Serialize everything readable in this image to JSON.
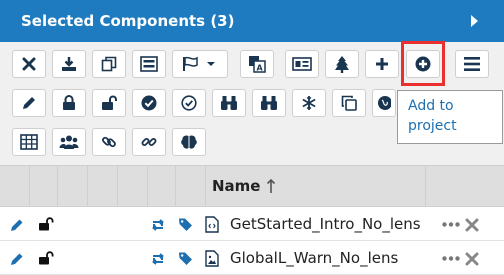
{
  "header": {
    "title": "Selected Components (3)",
    "expand_icon": "triangle-right-icon"
  },
  "toolbar": {
    "row1": [
      "close-icon",
      "download-icon",
      "copy-icon",
      "list-icon",
      "flag-icon",
      "translate-icon",
      "id-card-icon",
      "tree-icon",
      "plus-icon",
      "plus-circle-icon",
      "menu-icon"
    ],
    "row2": [
      "pencil-icon",
      "lock-icon",
      "unlock-icon",
      "check-circle-icon",
      "check-circle-outline-icon",
      "binoculars-icon",
      "binoculars-icon",
      "snowflake-icon",
      "clone-icon",
      "globe-icon"
    ],
    "row3": [
      "table-icon",
      "users-icon",
      "link-icon",
      "unlink-icon",
      "brain-icon"
    ]
  },
  "tooltip": {
    "text_line1": "Add to",
    "text_line2": "project"
  },
  "table": {
    "header": {
      "name_label": "Name"
    },
    "rows": [
      {
        "name": "GetStarted_Intro_No_lens",
        "file_type": "code"
      },
      {
        "name": "GlobalL_Warn_No_lens",
        "file_type": "image"
      }
    ]
  },
  "colors": {
    "accent": "#1e7bbf",
    "highlight": "#e8312f",
    "icon": "#1a4f7a"
  }
}
